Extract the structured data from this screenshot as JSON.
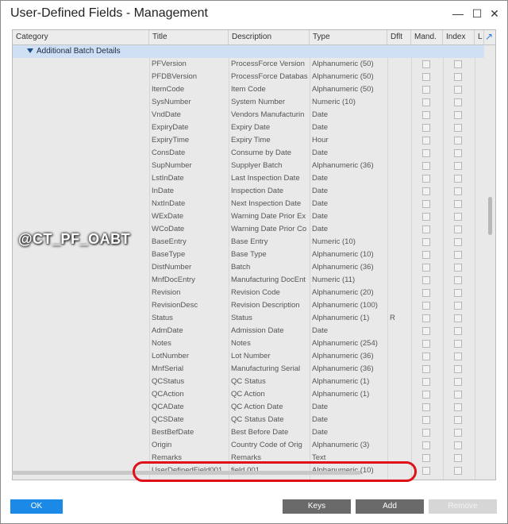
{
  "window": {
    "title": "User-Defined Fields - Management"
  },
  "columns": [
    "Category",
    "Title",
    "Description",
    "Type",
    "Dflt",
    "Mand.",
    "Index",
    "L"
  ],
  "category": "Additional Batch Details",
  "rows": [
    {
      "title": "PFVersion",
      "desc": "ProcessForce Version",
      "type": "Alphanumeric (50)",
      "dflt": ""
    },
    {
      "title": "PFDBVersion",
      "desc": "ProcessForce Databas",
      "type": "Alphanumeric (50)",
      "dflt": ""
    },
    {
      "title": "ItemCode",
      "desc": "Item Code",
      "type": "Alphanumeric (50)",
      "dflt": ""
    },
    {
      "title": "SysNumber",
      "desc": "System Number",
      "type": "Numeric (10)",
      "dflt": ""
    },
    {
      "title": "VndDate",
      "desc": "Vendors Manufacturin",
      "type": "Date",
      "dflt": ""
    },
    {
      "title": "ExpiryDate",
      "desc": "Expiry Date",
      "type": "Date",
      "dflt": ""
    },
    {
      "title": "ExpiryTime",
      "desc": "Expiry Time",
      "type": "Hour",
      "dflt": ""
    },
    {
      "title": "ConsDate",
      "desc": "Consume by Date",
      "type": "Date",
      "dflt": ""
    },
    {
      "title": "SupNumber",
      "desc": "Supplyer Batch",
      "type": "Alphanumeric (36)",
      "dflt": ""
    },
    {
      "title": "LstInDate",
      "desc": "Last Inspection Date",
      "type": "Date",
      "dflt": ""
    },
    {
      "title": "InDate",
      "desc": "Inspection Date",
      "type": "Date",
      "dflt": ""
    },
    {
      "title": "NxtInDate",
      "desc": "Next Inspection Date",
      "type": "Date",
      "dflt": ""
    },
    {
      "title": "WExDate",
      "desc": "Warning Date Prior Ex",
      "type": "Date",
      "dflt": ""
    },
    {
      "title": "WCoDate",
      "desc": "Warning Date Prior Co",
      "type": "Date",
      "dflt": ""
    },
    {
      "title": "BaseEntry",
      "desc": "Base Entry",
      "type": "Numeric (10)",
      "dflt": ""
    },
    {
      "title": "BaseType",
      "desc": "Base Type",
      "type": "Alphanumeric (10)",
      "dflt": ""
    },
    {
      "title": "DistNumber",
      "desc": "Batch",
      "type": "Alphanumeric (36)",
      "dflt": ""
    },
    {
      "title": "MnfDocEntry",
      "desc": "Manufacturing DocEnt",
      "type": "Numeric (11)",
      "dflt": ""
    },
    {
      "title": "Revision",
      "desc": "Revision Code",
      "type": "Alphanumeric (20)",
      "dflt": ""
    },
    {
      "title": "RevisionDesc",
      "desc": "Revision Description",
      "type": "Alphanumeric (100)",
      "dflt": ""
    },
    {
      "title": "Status",
      "desc": "Status",
      "type": "Alphanumeric (1)",
      "dflt": "R"
    },
    {
      "title": "AdmDate",
      "desc": "Admission Date",
      "type": "Date",
      "dflt": ""
    },
    {
      "title": "Notes",
      "desc": "Notes",
      "type": "Alphanumeric (254)",
      "dflt": ""
    },
    {
      "title": "LotNumber",
      "desc": "Lot Number",
      "type": "Alphanumeric (36)",
      "dflt": ""
    },
    {
      "title": "MnfSerial",
      "desc": "Manufacturing Serial",
      "type": "Alphanumeric (36)",
      "dflt": ""
    },
    {
      "title": "QCStatus",
      "desc": "QC Status",
      "type": "Alphanumeric (1)",
      "dflt": ""
    },
    {
      "title": "QCAction",
      "desc": "QC Action",
      "type": "Alphanumeric (1)",
      "dflt": ""
    },
    {
      "title": "QCADate",
      "desc": "QC Action Date",
      "type": "Date",
      "dflt": ""
    },
    {
      "title": "QCSDate",
      "desc": "QC Status Date",
      "type": "Date",
      "dflt": ""
    },
    {
      "title": "BestBefDate",
      "desc": "Best Before Date",
      "type": "Date",
      "dflt": ""
    },
    {
      "title": "Origin",
      "desc": "Country Code of Orig",
      "type": "Alphanumeric (3)",
      "dflt": ""
    },
    {
      "title": "Remarks",
      "desc": "Remarks",
      "type": "Text",
      "dflt": ""
    },
    {
      "title": "UserDefinedField001",
      "desc": "field 001",
      "type": "Alphanumeric (10)",
      "dflt": ""
    }
  ],
  "watermark": "@CT_PF_OABT",
  "buttons": {
    "ok": "OK",
    "keys": "Keys",
    "add": "Add",
    "remove": "Remove"
  },
  "icons": {
    "minimize": "minimize-icon",
    "maximize": "maximize-icon",
    "close": "close-icon",
    "expand": "expand-icon"
  }
}
